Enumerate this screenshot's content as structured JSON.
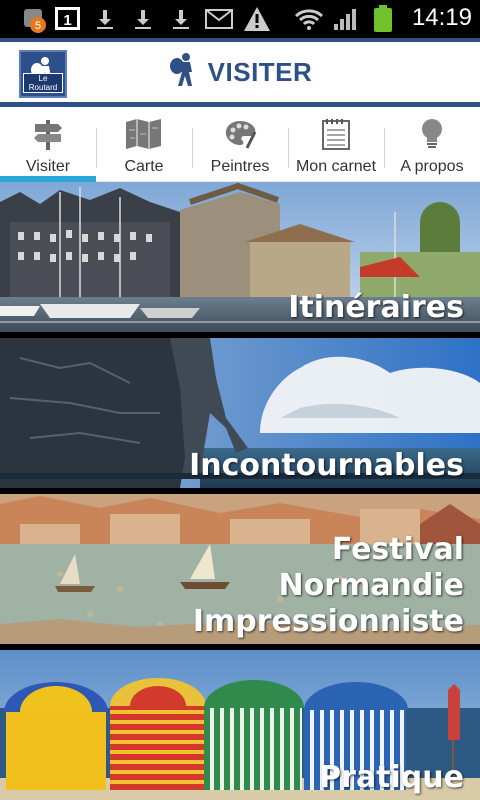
{
  "status_bar": {
    "notification_count": "5",
    "sim_indicator": "1",
    "time": "14:19",
    "icons": [
      "app-notification-icon",
      "sim-icon",
      "download-icon",
      "download-icon",
      "download-icon",
      "mail-icon",
      "warning-icon",
      "wifi-icon",
      "signal-icon",
      "battery-icon"
    ]
  },
  "header": {
    "logo_text": "Le Routard",
    "title": "VISITER",
    "accent_color": "#2f4f87"
  },
  "tabs": [
    {
      "label": "Visiter",
      "icon": "signpost-icon",
      "active": true
    },
    {
      "label": "Carte",
      "icon": "map-icon",
      "active": false
    },
    {
      "label": "Peintres",
      "icon": "palette-icon",
      "active": false
    },
    {
      "label": "Mon carnet",
      "icon": "notebook-icon",
      "active": false
    },
    {
      "label": "A propos",
      "icon": "lightbulb-icon",
      "active": false
    }
  ],
  "cards": [
    {
      "label": "Itinéraires"
    },
    {
      "label": "Incontournables"
    },
    {
      "label_line1": "Festival",
      "label_line2": "Normandie Impressionniste"
    },
    {
      "label": "Pratique"
    }
  ],
  "colors": {
    "active_tab_indicator": "#2aa7d8",
    "battery": "#6fc22b"
  }
}
